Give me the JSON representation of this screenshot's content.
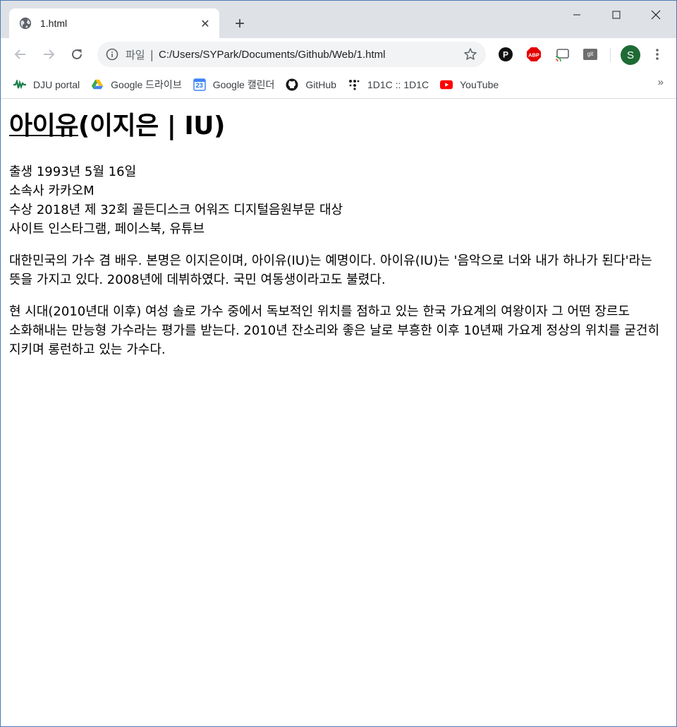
{
  "browser": {
    "tab_title": "1.html",
    "tab_close": "✕",
    "new_tab": "+",
    "omnibox": {
      "scheme": "파일",
      "separator": "|",
      "url": "C:/Users/SYPark/Documents/Github/Web/1.html"
    },
    "avatar_letter": "S",
    "extensions": {
      "git": "git"
    },
    "bookmarks": [
      {
        "label": "DJU portal",
        "icon": "dju-icon"
      },
      {
        "label": "Google 드라이브",
        "icon": "google-drive-icon"
      },
      {
        "label": "Google 캘린더",
        "icon": "google-calendar-icon",
        "badge": "23"
      },
      {
        "label": "GitHub",
        "icon": "github-icon"
      },
      {
        "label": "1D1C :: 1D1C",
        "icon": "dots-icon"
      },
      {
        "label": "YouTube",
        "icon": "youtube-icon"
      }
    ],
    "bookmarks_more": "»",
    "colors": {
      "titlebar": "#dee1e6",
      "accent_avatar": "#1e6b35",
      "youtube_red": "#ff0000",
      "abp_red": "#e40000"
    }
  },
  "page": {
    "title_link": "아이유",
    "title_rest": "(이지은 | IU)",
    "info": [
      "출생 1993년 5월 16일",
      "소속사 카카오M",
      "수상 2018년 제 32회 골든디스크 어워즈 디지털음원부문 대상",
      "사이트 인스타그램, 페이스북, 유튜브"
    ],
    "paragraphs": [
      "대한민국의 가수 겸 배우. 본명은 이지은이며, 아이유(IU)는 예명이다. 아이유(IU)는 '음악으로 너와 내가 하나가 된다'라는 뜻을 가지고 있다. 2008년에 데뷔하였다. 국민 여동생이라고도 불렸다.",
      "현 시대(2010년대 이후) 여성 솔로 가수 중에서 독보적인 위치를 점하고 있는 한국 가요계의 여왕이자 그 어떤 장르도 소화해내는 만능형 가수라는 평가를 받는다. 2010년 잔소리와 좋은 날로 부흥한 이후 10년째 가요계 정상의 위치를 굳건히 지키며 롱런하고 있는 가수다."
    ]
  }
}
